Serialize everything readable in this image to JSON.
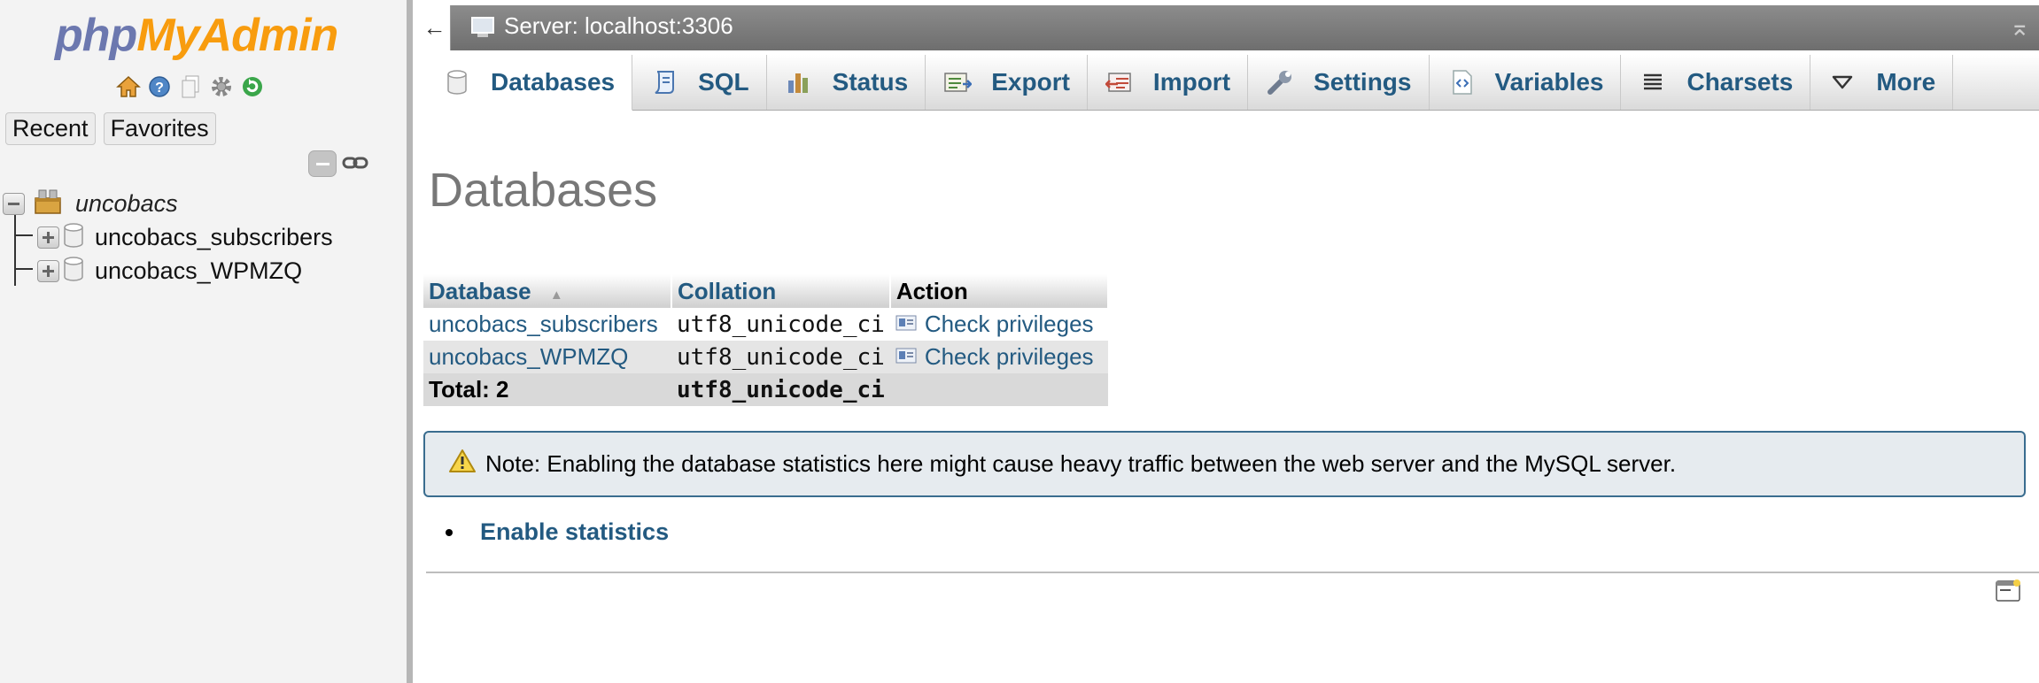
{
  "nav": {
    "logo_part1": "php",
    "logo_part2": "MyAdmin",
    "icons": [
      "home-icon",
      "info-icon",
      "docs-icon",
      "settings-icon",
      "reload-icon"
    ],
    "tabs": {
      "recent": "Recent",
      "favorites": "Favorites"
    },
    "tree": {
      "group": "uncobacs",
      "databases": [
        "uncobacs_subscribers",
        "uncobacs_WPMZQ"
      ]
    }
  },
  "serverbar": {
    "back": "←",
    "title": "Server: localhost:3306",
    "scroll_top": "⌅"
  },
  "tabs": [
    {
      "label": "Databases",
      "icon": "database-icon",
      "active": true
    },
    {
      "label": "SQL",
      "icon": "sql-icon"
    },
    {
      "label": "Status",
      "icon": "status-icon"
    },
    {
      "label": "Export",
      "icon": "export-icon"
    },
    {
      "label": "Import",
      "icon": "import-icon"
    },
    {
      "label": "Settings",
      "icon": "wrench-icon"
    },
    {
      "label": "Variables",
      "icon": "variables-icon"
    },
    {
      "label": "Charsets",
      "icon": "charsets-icon"
    },
    {
      "label": "More",
      "icon": "triangle-down-icon"
    }
  ],
  "main": {
    "title": "Databases",
    "table": {
      "headers": {
        "database": "Database",
        "collation": "Collation",
        "action": "Action"
      },
      "rows": [
        {
          "database": "uncobacs_subscribers",
          "collation": "utf8_unicode_ci",
          "action": "Check privileges"
        },
        {
          "database": "uncobacs_WPMZQ",
          "collation": "utf8_unicode_ci",
          "action": "Check privileges"
        }
      ],
      "total": {
        "label": "Total: 2",
        "collation": "utf8_unicode_ci"
      }
    },
    "note": "Note: Enabling the database statistics here might cause heavy traffic between the web server and the MySQL server.",
    "enable_statistics": "Enable statistics"
  },
  "colors": {
    "link": "#235a81",
    "logo_php": "#6c78af",
    "logo_myadmin": "#f89c0e",
    "note_border": "#3a6d8f",
    "note_bg": "#e6ebef"
  }
}
